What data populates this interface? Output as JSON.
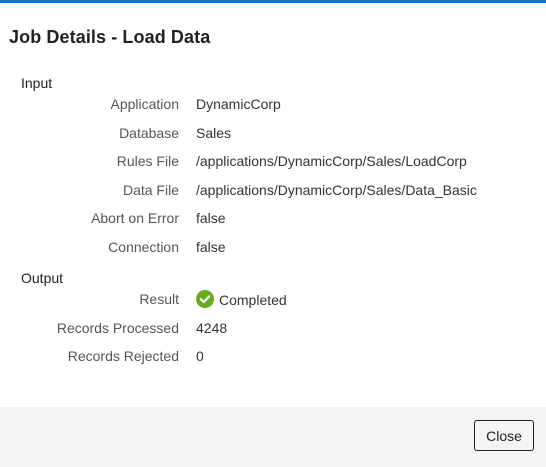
{
  "dialog": {
    "title": "Job Details - Load Data",
    "accent_color": "#0a72d6"
  },
  "input": {
    "section_label": "Input",
    "fields": [
      {
        "label": "Application",
        "value": "DynamicCorp"
      },
      {
        "label": "Database",
        "value": "Sales"
      },
      {
        "label": "Rules File",
        "value": "/applications/DynamicCorp/Sales/LoadCorp"
      },
      {
        "label": "Data File",
        "value": "/applications/DynamicCorp/Sales/Data_Basic"
      },
      {
        "label": "Abort on Error",
        "value": "false"
      },
      {
        "label": "Connection",
        "value": "false"
      }
    ]
  },
  "output": {
    "section_label": "Output",
    "result": {
      "label": "Result",
      "value": "Completed",
      "icon": "check-circle-icon",
      "icon_color": "#6aaa1e"
    },
    "records_processed": {
      "label": "Records Processed",
      "value": "4248"
    },
    "records_rejected": {
      "label": "Records Rejected",
      "value": "0"
    }
  },
  "footer": {
    "close_label": "Close"
  }
}
